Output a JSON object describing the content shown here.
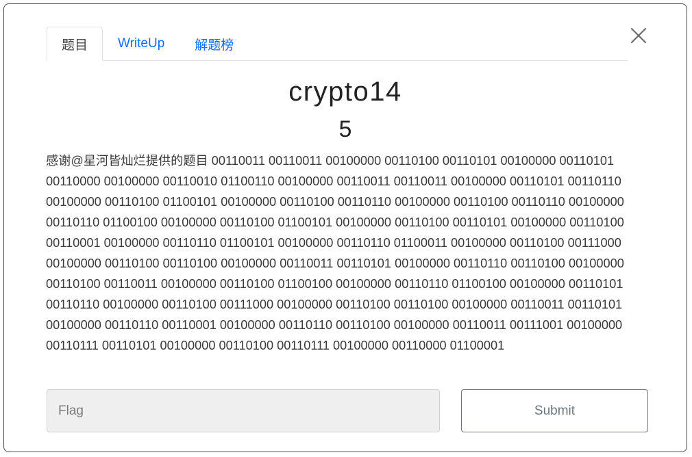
{
  "tabs": [
    {
      "label": "题目",
      "active": true
    },
    {
      "label": "WriteUp",
      "active": false
    },
    {
      "label": "解题榜",
      "active": false
    }
  ],
  "close_icon": "close-icon",
  "challenge": {
    "name": "crypto14",
    "value": "5",
    "description": "感谢@星河皆灿烂提供的题目 00110011 00110011 00100000 00110100 00110101 00100000 00110101 00110000 00100000 00110010 01100110 00100000 00110011 00110011 00100000 00110101 00110110 00100000 00110100 01100101 00100000 00110100 00110110 00100000 00110100 00110110 00100000 00110110 01100100 00100000 00110100 01100101 00100000 00110100 00110101 00100000 00110100 00110001 00100000 00110110 01100101 00100000 00110110 01100011 00100000 00110100 00111000 00100000 00110100 00110100 00100000 00110011 00110101 00100000 00110110 00110100 00100000 00110100 00110011 00100000 00110100 01100100 00100000 00110110 01100100 00100000 00110101 00110110 00100000 00110100 00111000 00100000 00110100 00110100 00100000 00110011 00110101 00100000 00110110 00110001 00100000 00110110 00110100 00100000 00110011 00111001 00100000 00110111 00110101 00100000 00110100 00110111 00100000 00110000 01100001"
  },
  "form": {
    "flag_placeholder": "Flag",
    "flag_value": "",
    "submit_label": "Submit"
  },
  "colors": {
    "tab_link": "#0d6efd",
    "border": "#4a4a4a",
    "input_bg": "#efefef",
    "button_text": "#6c757d"
  }
}
